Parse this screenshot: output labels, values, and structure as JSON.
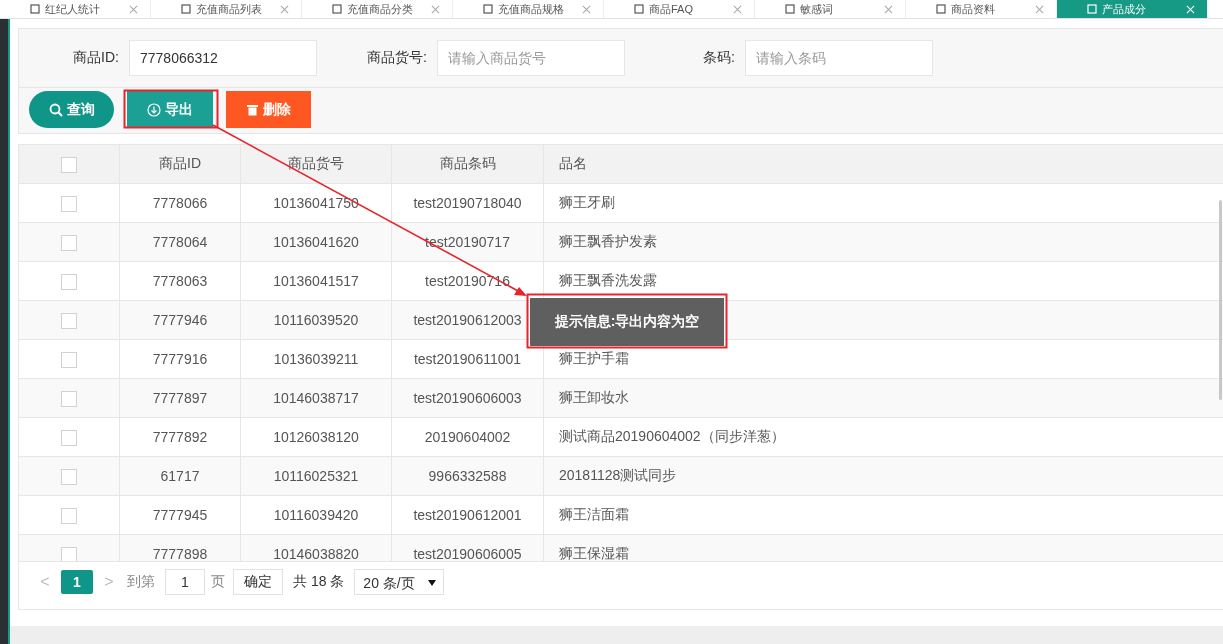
{
  "tabs": [
    {
      "label": "红纪人统计",
      "selected": false
    },
    {
      "label": "充值商品列表",
      "selected": false
    },
    {
      "label": "充值商品分类",
      "selected": false
    },
    {
      "label": "充值商品规格",
      "selected": false
    },
    {
      "label": "商品FAQ",
      "selected": false
    },
    {
      "label": "敏感词",
      "selected": false
    },
    {
      "label": "商品资料",
      "selected": false
    },
    {
      "label": "产品成分",
      "selected": true
    }
  ],
  "filters": [
    {
      "label": "商品ID:",
      "value": "7778066312"
    },
    {
      "label": "商品货号:",
      "placeholder": "请输入商品货号"
    },
    {
      "label": "条码:",
      "placeholder": "请输入条码"
    }
  ],
  "buttons": [
    {
      "kind": "search",
      "label": "查询"
    },
    {
      "kind": "export",
      "label": "导出"
    },
    {
      "kind": "delete",
      "label": "删除"
    }
  ],
  "table": {
    "header_checked": false,
    "columns": [
      "商品ID",
      "商品货号",
      "商品条码",
      "品名"
    ],
    "rows": [
      {
        "checked": false,
        "cells": [
          "7778066",
          "10136041750",
          "test20190718040",
          "狮王牙刷"
        ]
      },
      {
        "checked": false,
        "cells": [
          "7778064",
          "10136041620",
          "test20190717",
          "狮王飘香护发素"
        ]
      },
      {
        "checked": false,
        "cells": [
          "7778063",
          "10136041517",
          "test20190716",
          "狮王飘香洗发露"
        ]
      },
      {
        "checked": false,
        "cells": [
          "7777946",
          "10116039520",
          "test20190612003",
          ""
        ]
      },
      {
        "checked": false,
        "cells": [
          "7777916",
          "10136039211",
          "test20190611001",
          "狮王护手霜"
        ]
      },
      {
        "checked": false,
        "cells": [
          "7777897",
          "10146038717",
          "test20190606003",
          "狮王卸妆水"
        ]
      },
      {
        "checked": false,
        "cells": [
          "7777892",
          "10126038120",
          "20190604002",
          "测试商品20190604002（同步洋葱）"
        ]
      },
      {
        "checked": false,
        "cells": [
          "61717",
          "10116025321",
          "9966332588",
          "20181128测试同步"
        ]
      },
      {
        "checked": false,
        "cells": [
          "7777945",
          "10116039420",
          "test20190612001",
          "狮王洁面霜"
        ]
      },
      {
        "checked": false,
        "cells": [
          "7777898",
          "10146038820",
          "test20190606005",
          "狮王保湿霜"
        ]
      }
    ]
  },
  "pagination": {
    "prev": "<",
    "current": "1",
    "next": ">",
    "goto_label": "到第",
    "page_value": "1",
    "page_unit": "页",
    "confirm": "确定",
    "total": "共 18 条",
    "page_size": "20 条/页"
  },
  "tooltip": "提示信息:导出内容为空"
}
